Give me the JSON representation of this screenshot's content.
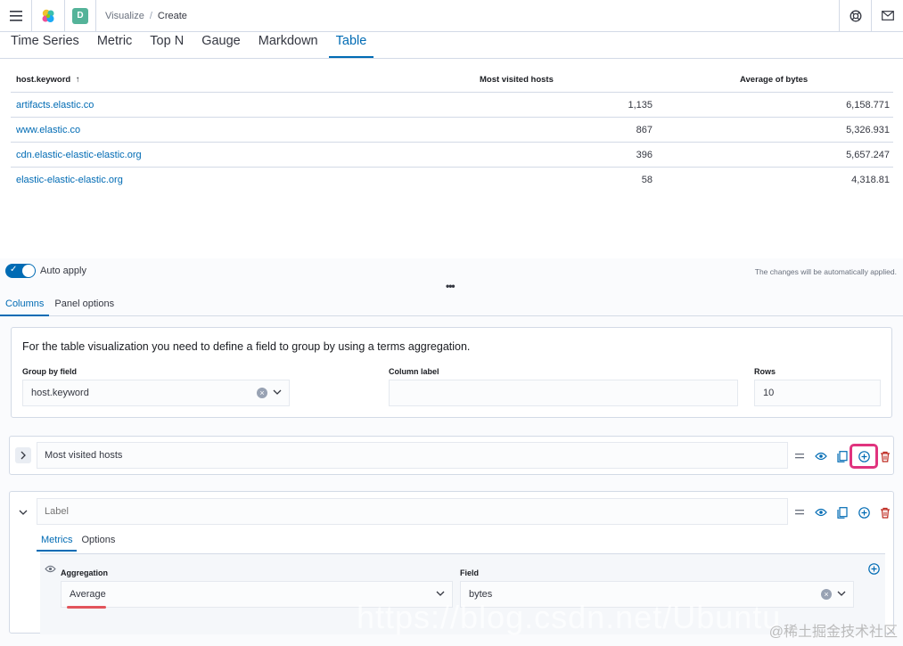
{
  "header": {
    "space_initial": "D",
    "breadcrumb_parent": "Visualize",
    "breadcrumb_sep": "/",
    "breadcrumb_current": "Create"
  },
  "vis_tabs": [
    "Time Series",
    "Metric",
    "Top N",
    "Gauge",
    "Markdown",
    "Table"
  ],
  "vis_active": "Table",
  "table": {
    "headers": [
      "host.keyword",
      "Most visited hosts",
      "Average of bytes"
    ],
    "sort_indicator": "↑",
    "rows": [
      [
        "artifacts.elastic.co",
        "1,135",
        "6,158.771"
      ],
      [
        "www.elastic.co",
        "867",
        "5,326.931"
      ],
      [
        "cdn.elastic-elastic-elastic.org",
        "396",
        "5,657.247"
      ],
      [
        "elastic-elastic-elastic.org",
        "58",
        "4,318.81"
      ]
    ]
  },
  "editor": {
    "auto_apply_label": "Auto apply",
    "auto_apply_note": "The changes will be automatically applied.",
    "drag_handle": "•••",
    "tabs": [
      "Columns",
      "Panel options"
    ],
    "intro": "For the table visualization you need to define a field to group by using a terms aggregation.",
    "group_by_label": "Group by field",
    "group_by_value": "host.keyword",
    "column_label_label": "Column label",
    "column_label_value": "",
    "rows_label": "Rows",
    "rows_value": "10",
    "series1_label": "Most visited hosts",
    "series2_placeholder": "Label",
    "series2_tabs": [
      "Metrics",
      "Options"
    ],
    "aggregation_label": "Aggregation",
    "aggregation_value": "Average",
    "field_label": "Field",
    "field_value": "bytes"
  },
  "colors": {
    "primary": "#006bb4",
    "highlight": "#e0337e",
    "danger": "#bd271e"
  },
  "watermark_text": "https://blog.csdn.net/Ubuntu",
  "watermark_corner": "@稀土掘金技术社区"
}
